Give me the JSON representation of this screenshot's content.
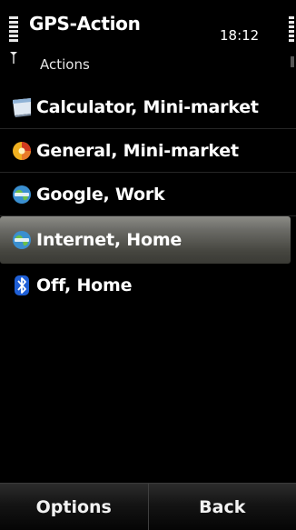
{
  "status": {
    "app_title": "GPS-Action",
    "clock": "18:12",
    "subtitle": "Actions"
  },
  "list": {
    "items": [
      {
        "label": "Calculator, Mini-market",
        "icon": "calculator-icon"
      },
      {
        "label": "General, Mini-market",
        "icon": "profile-icon"
      },
      {
        "label": "Google, Work",
        "icon": "globe-icon"
      },
      {
        "label": "Internet, Home",
        "icon": "globe-icon",
        "selected": true
      },
      {
        "label": "Off, Home",
        "icon": "bluetooth-icon"
      }
    ]
  },
  "softkeys": {
    "left": "Options",
    "right": "Back"
  },
  "colors": {
    "background": "#000000",
    "highlight": "#6a6a65",
    "text": "#ffffff"
  }
}
